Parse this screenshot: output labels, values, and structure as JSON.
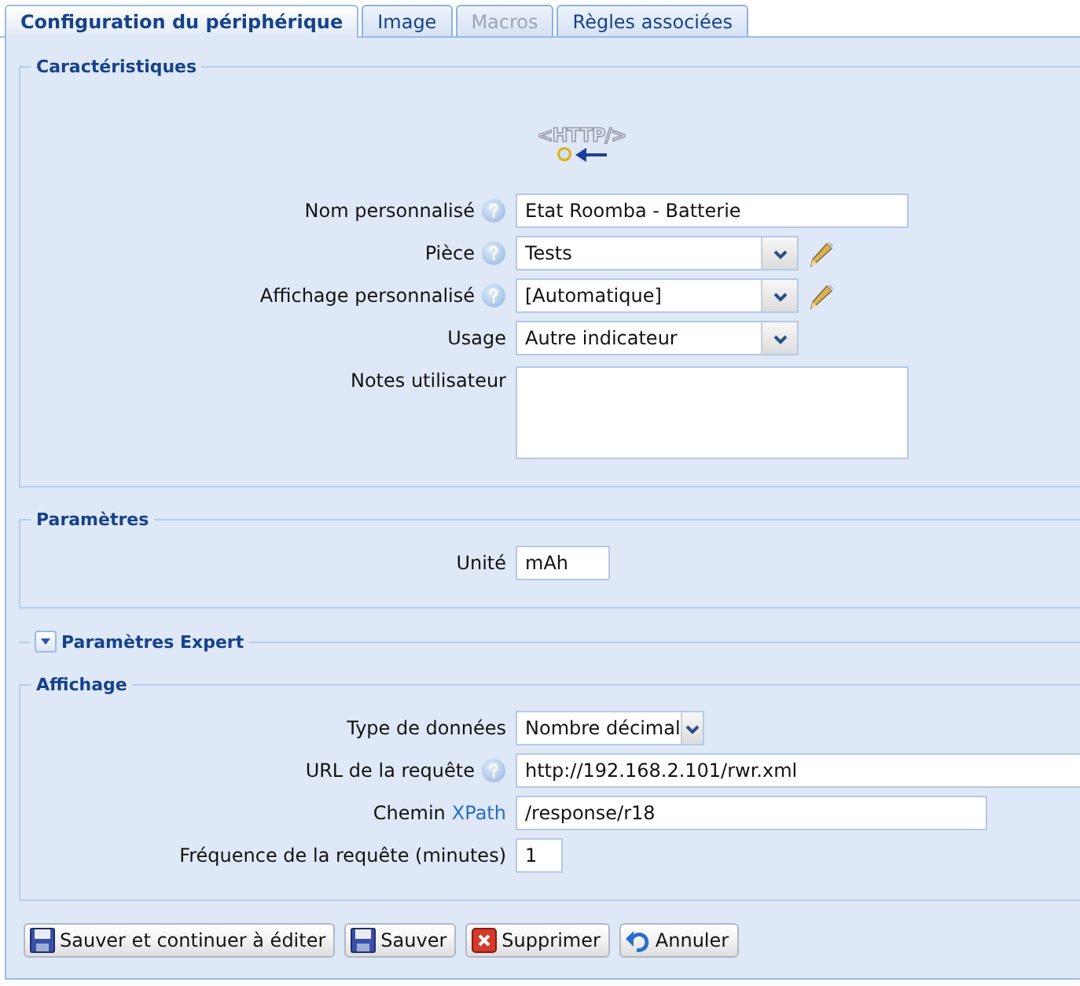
{
  "tabs": [
    {
      "label": "Configuration du périphérique",
      "selected": true,
      "disabled": false
    },
    {
      "label": "Image",
      "selected": false,
      "disabled": false
    },
    {
      "label": "Macros",
      "selected": false,
      "disabled": true
    },
    {
      "label": "Règles associées",
      "selected": false,
      "disabled": false
    }
  ],
  "sections": [
    {
      "title": "Caractéristiques",
      "kind": "group",
      "logo": {
        "text": "<HTTP/>"
      },
      "fields": [
        {
          "label": "Nom personnalisé",
          "help": true,
          "kind": "text",
          "value": "Etat Roomba - Batterie"
        },
        {
          "label": "Pièce",
          "help": true,
          "kind": "select",
          "value": "Tests",
          "editable": true
        },
        {
          "label": "Affichage personnalisé",
          "help": true,
          "kind": "select",
          "value": "[Automatique]",
          "editable": true
        },
        {
          "label": "Usage",
          "kind": "select",
          "value": "Autre indicateur"
        },
        {
          "label": "Notes utilisateur",
          "kind": "textarea"
        }
      ]
    },
    {
      "title": "Paramètres",
      "kind": "group",
      "fields": [
        {
          "label": "Unité",
          "kind": "text",
          "value": "mAh"
        }
      ]
    },
    {
      "title": "Paramètres Expert",
      "kind": "collapsible",
      "expanded": false
    },
    {
      "title": "Affichage",
      "kind": "group",
      "fields": [
        {
          "label": "Type de données",
          "kind": "select",
          "value": "Nombre décimal"
        },
        {
          "label": "URL de la requête",
          "help": true,
          "kind": "text",
          "value": "http://192.168.2.101/rwr.xml"
        },
        {
          "label": "Chemin",
          "link": "XPath",
          "kind": "text",
          "value": "/response/r18"
        },
        {
          "label": "Fréquence de la requête (minutes)",
          "kind": "text",
          "value": "1"
        }
      ]
    }
  ],
  "buttons": [
    {
      "label": "Sauver et continuer à éditer",
      "kind": "save"
    },
    {
      "label": "Sauver",
      "kind": "save"
    },
    {
      "label": "Supprimer",
      "kind": "delete"
    },
    {
      "label": "Annuler",
      "kind": "undo"
    }
  ]
}
